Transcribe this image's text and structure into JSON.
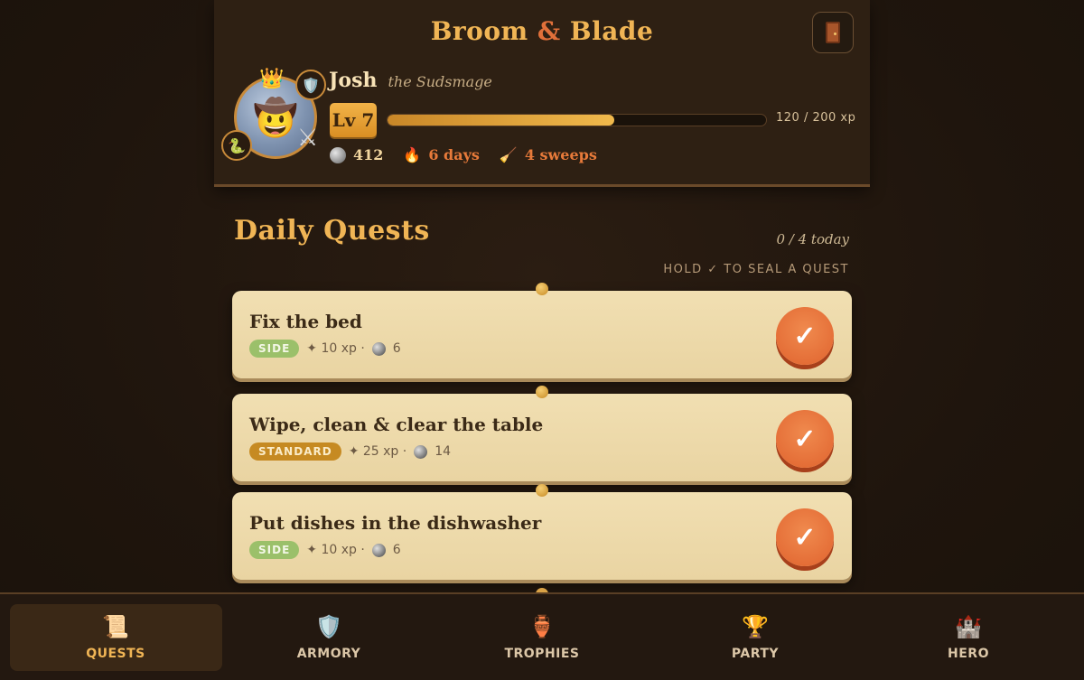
{
  "app": {
    "title_left": "Broom",
    "title_amp": "&",
    "title_right": "Blade",
    "logout_icon": "door-icon"
  },
  "hero": {
    "name": "Josh",
    "epithet": "the Sudsmage",
    "level_label": "Lv 7",
    "xp_text": "120 / 200 xp",
    "xp_fraction": 0.6,
    "avatar_emoji": "🤠",
    "crown_emoji": "👑",
    "shield_emoji": "🛡️",
    "serpent_emoji": "🐍",
    "sword_glyph": "⚔",
    "coins": "412",
    "streak": "6 days",
    "sweeps": "4 sweeps",
    "flame_emoji": "🔥",
    "broom_emoji": "🧹"
  },
  "quests_section": {
    "title": "Daily Quests",
    "today": "0 / 4 today",
    "hint": "HOLD ✓ TO SEAL A QUEST"
  },
  "quests": [
    {
      "title": "Fix the bed",
      "tag": "SIDE",
      "xp": "✦ 10 xp ·",
      "coins": "6"
    },
    {
      "title": "Wipe, clean & clear the table",
      "tag": "STANDARD",
      "xp": "✦ 25 xp ·",
      "coins": "14"
    },
    {
      "title": "Put dishes in the dishwasher",
      "tag": "SIDE",
      "xp": "✦ 10 xp ·",
      "coins": "6"
    }
  ],
  "check_glyph": "✓",
  "nav": [
    {
      "label": "QUESTS",
      "icon": "📜",
      "active": true
    },
    {
      "label": "ARMORY",
      "icon": "🛡️",
      "active": false
    },
    {
      "label": "TROPHIES",
      "icon": "🏺",
      "active": false
    },
    {
      "label": "PARTY",
      "icon": "🏆",
      "active": false
    },
    {
      "label": "HERO",
      "icon": "🏰",
      "active": false
    }
  ],
  "colors": {
    "accent_gold": "#f0b555",
    "accent_orange": "#e0632e",
    "tag_side": "#9bc06a",
    "tag_standard": "#c68a22"
  }
}
